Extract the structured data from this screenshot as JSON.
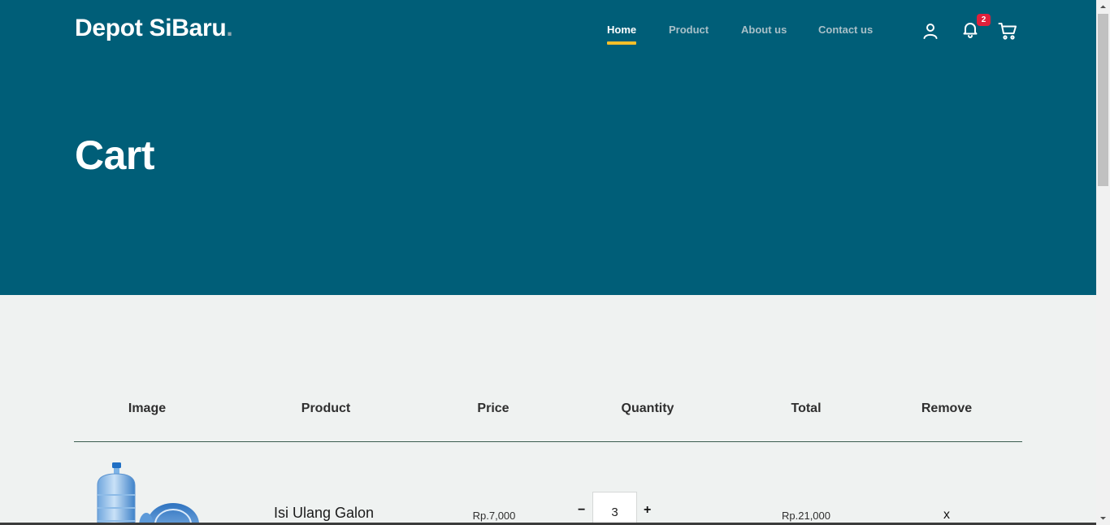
{
  "brand": {
    "name": "Depot SiBaru",
    "dot": "."
  },
  "nav": {
    "items": [
      {
        "label": "Home",
        "active": true
      },
      {
        "label": "Product",
        "active": false
      },
      {
        "label": "About us",
        "active": false
      },
      {
        "label": "Contact us",
        "active": false
      }
    ],
    "icons": [
      "user-icon",
      "bell-icon",
      "cart-icon"
    ],
    "notification_count": "2"
  },
  "colors": {
    "hero_bg": "#005e78",
    "accent": "#f9bf29",
    "badge": "#e0203b",
    "page_bg": "#eff2f1",
    "divider": "#3b5d50"
  },
  "page": {
    "title": "Cart"
  },
  "table": {
    "headers": [
      "Image",
      "Product",
      "Price",
      "Quantity",
      "Total",
      "Remove"
    ],
    "rows": [
      {
        "image": "water-gallon-image",
        "product": "Isi Ulang Galon",
        "price": "Rp.7,000",
        "quantity": "3",
        "total": "Rp.21,000",
        "remove": "x",
        "minus": "−",
        "plus": "+"
      }
    ]
  }
}
